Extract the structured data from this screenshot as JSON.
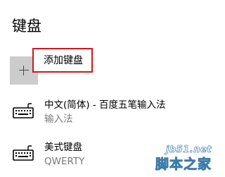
{
  "page": {
    "title": "键盘"
  },
  "add_keyboard": {
    "label": "添加键盘",
    "icon": "plus-icon",
    "highlight_color": "#d01818",
    "icon_bg_color": "#cccccc"
  },
  "keyboards": [
    {
      "name": "中文(简体) - 百度五笔输入法",
      "subtitle": "输入法",
      "icon": "keyboard-icon"
    },
    {
      "name": "美式键盘",
      "subtitle": "QWERTY",
      "icon": "keyboard-icon"
    }
  ],
  "watermark": {
    "url": "jb51.net",
    "brand": "脚本之家"
  },
  "colors": {
    "text": "#000000",
    "secondary_text": "#7a7a7a",
    "watermark_outline": "#3c7ca8"
  }
}
